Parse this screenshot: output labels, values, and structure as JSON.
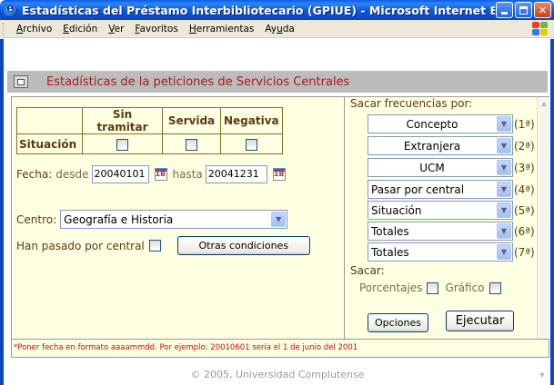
{
  "window": {
    "title": "Estadísticas del Préstamo Interbibliotecario (GPIUE) - Microsoft Internet Ex...",
    "title_bar_color": "#0a5ee8"
  },
  "menu": {
    "items": [
      {
        "ul": "A",
        "rest": "rchivo"
      },
      {
        "ul": "E",
        "rest": "dición"
      },
      {
        "ul": "V",
        "rest": "er"
      },
      {
        "ul": "F",
        "rest": "avoritos"
      },
      {
        "ul": "H",
        "rest": "erramientas"
      },
      {
        "pre": "Ay",
        "ul": "u",
        "rest": "da"
      }
    ]
  },
  "header": {
    "title": "Estadísticas de la peticiones de Servicios Centrales",
    "title_color": "#b01818"
  },
  "status_table": {
    "columns": [
      "Sin tramitar",
      "Servida",
      "Negativa"
    ],
    "row_label": "Situación"
  },
  "fecha": {
    "label": "Fecha:",
    "desde_label": "desde",
    "desde_value": "20040101",
    "hasta_label": "hasta",
    "hasta_value": "20041231",
    "calendar_icon_text": "18"
  },
  "centro": {
    "label": "Centro:",
    "value": "Geografía e Historia"
  },
  "pasado": {
    "label": "Han pasado por central",
    "otras_button": "Otras condiciones"
  },
  "frecuencias": {
    "title": "Sacar frecuencias por:",
    "selects": [
      {
        "value": "Concepto",
        "index": "(1ª)"
      },
      {
        "value": "Extranjera",
        "index": "(2ª)"
      },
      {
        "value": "UCM",
        "index": "(3ª)"
      },
      {
        "value": "Pasar por central",
        "index": "(4ª)"
      },
      {
        "value": "Situación",
        "index": "(5ª)"
      },
      {
        "value": "Totales",
        "index": "(6ª)"
      },
      {
        "value": "Totales",
        "index": "(7ª)"
      }
    ]
  },
  "sacar": {
    "title": "Sacar:",
    "porcentajes_label": "Porcentajes",
    "grafico_label": "Gráfico"
  },
  "actions": {
    "opciones": "Opciones",
    "ejecutar": "Ejecutar"
  },
  "footnote": "*Poner fecha en formato aaaammdd. Por ejemplo: 20010601 sería el 1 de junio del 2001",
  "copyright": "© 2005, Universidad Complutense",
  "colors": {
    "form_bg": "#ffffe1",
    "header_bg": "#bcbcbc",
    "label_brown": "#5b3b12",
    "footnote_red": "#c01010"
  }
}
